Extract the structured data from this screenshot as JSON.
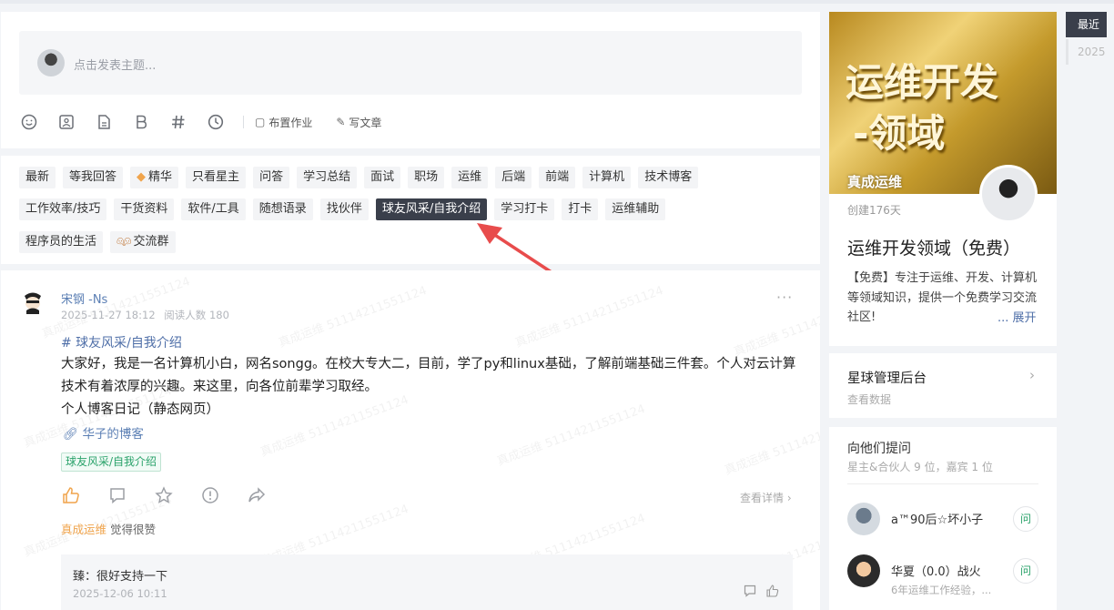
{
  "composer": {
    "placeholder": "点击发表主题...",
    "toolbar": {
      "icons": [
        "emoji-icon",
        "image-icon",
        "file-icon",
        "bold-icon",
        "hashtag-icon",
        "clock-icon"
      ],
      "assign_homework": "布置作业",
      "write_article": "写文章"
    }
  },
  "tags": {
    "row1": [
      "最新",
      "等我回答",
      "精华",
      "只看星主",
      "问答",
      "学习总结",
      "面试",
      "职场",
      "运维",
      "后端",
      "前端",
      "计算机",
      "技术博客"
    ],
    "row2": [
      "工作效率/技巧",
      "干货资料",
      "软件/工具",
      "随想语录",
      "找伙伴",
      "球友风采/自我介绍",
      "学习打卡",
      "打卡",
      "运维辅助"
    ],
    "row3": [
      "程序员的生活",
      "交流群"
    ],
    "active": "球友风采/自我介绍",
    "colors": {
      "active_bg": "#3a3f4b",
      "arrow": "#e84c4c"
    }
  },
  "post": {
    "author": "宋钢 -Ns",
    "date": "2025-11-27 18:12",
    "reads": "阅读人数 180",
    "hashtag": "# 球友风采/自我介绍",
    "body_line1": "大家好，我是一名计算机小白，网名songg。在校大专大二，目前，学了py和linux基础，了解前端基础三件套。个人对云计算技术有着浓厚的兴趣。来这里，向各位前辈学习取经。",
    "body_line2": "个人博客日记（静态网页）",
    "link": "华子的博客",
    "topic_tag": "球友风采/自我介绍",
    "detail": "查看详情",
    "likes_who": "真成运维",
    "likes_text": " 觉得很赞",
    "watermark": "真成运维 51114211551124",
    "comment": {
      "text": "臻：很好支持一下",
      "time": "2025-12-06 10:11"
    }
  },
  "group": {
    "banner_title_line1": "运维开发",
    "banner_title_line2": "-领域",
    "owner": "真成运维",
    "created": "创建176天",
    "name": "运维开发领域（免费）",
    "desc": "【免费】专注于运维、开发、计算机等领域知识，提供一个免费学习交流社区!",
    "expand": "... 展开"
  },
  "admin": {
    "title": "星球管理后台",
    "sub": "查看数据"
  },
  "ask": {
    "title": "向他们提问",
    "sub": "星主&合伙人 9 位，嘉宾 1 位",
    "people": [
      {
        "name": "a™90后☆坏小子",
        "desc": "",
        "button": "问"
      },
      {
        "name": "华夏（0.0）战火",
        "desc": "6年运维工作经验，...",
        "button": "问"
      }
    ]
  },
  "timeline": [
    "最近",
    "2025"
  ]
}
